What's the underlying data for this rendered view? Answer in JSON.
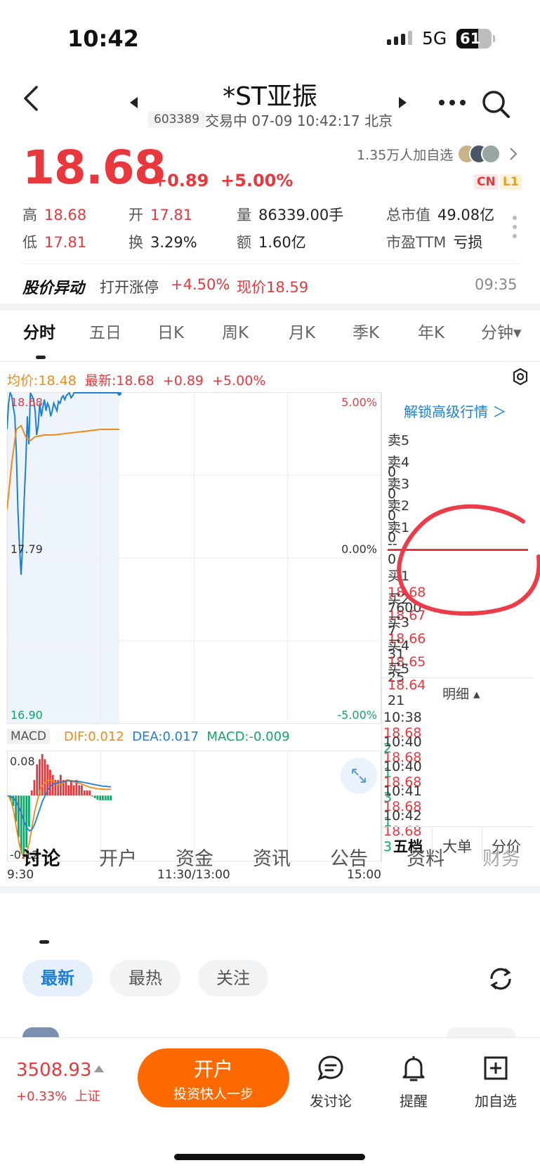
{
  "status_bar": {
    "time": "10:42",
    "network": "5G",
    "battery_level": 61,
    "battery_text": "61"
  },
  "header": {
    "title": "*ST亚振",
    "code": "603389",
    "subtitle": "交易中 07-09 10:42:17 北京"
  },
  "quote": {
    "price": "18.68",
    "change": "+0.89",
    "change_pct": "+5.00%",
    "fans": "1.35万人加自选",
    "tag_cn": "CN",
    "tag_l1": "L1",
    "high_label": "高",
    "high": "18.68",
    "open_label": "开",
    "open": "17.81",
    "volume_label": "量",
    "volume": "86339.00手",
    "mktcap_label": "总市值",
    "mktcap": "49.08亿",
    "low_label": "低",
    "low": "17.81",
    "turnover_label": "换",
    "turnover": "3.29%",
    "amount_label": "额",
    "amount": "1.60亿",
    "pe_label": "市盈TTM",
    "pe": "亏损"
  },
  "alert": {
    "title": "股价异动",
    "text": "打开涨停",
    "pct": "+4.50%",
    "price_text": "现价18.59",
    "time": "09:35"
  },
  "chart_tabs": [
    "分时",
    "五日",
    "日K",
    "周K",
    "月K",
    "季K",
    "年K",
    "分钟▾"
  ],
  "info_line": {
    "avg": "均价:18.48",
    "latest": "最新:18.68",
    "chg": "+0.89",
    "pct": "+5.00%"
  },
  "chart_data": {
    "type": "line",
    "y_left_ticks": [
      "18.68",
      "17.79",
      "16.90"
    ],
    "y_right_ticks": [
      "5.00%",
      "0.00%",
      "-5.00%"
    ],
    "x_ticks": [
      "9:30",
      "11:30/13:00",
      "15:00"
    ],
    "ylim": [
      16.9,
      18.68
    ],
    "series": [
      {
        "name": "price",
        "color": "#1e7fd6",
        "x": [
          0,
          1,
          2,
          3,
          4,
          5,
          6,
          7,
          8,
          9,
          10,
          11,
          12,
          13,
          14,
          15,
          16,
          17,
          18,
          19,
          20,
          21,
          22,
          23,
          24,
          25,
          26,
          27,
          28,
          29,
          30,
          31,
          32,
          33,
          34,
          35,
          36,
          37,
          38,
          39,
          40,
          41,
          42,
          43,
          44,
          45,
          46,
          47,
          48,
          49,
          50,
          51,
          52,
          53,
          54,
          55,
          56,
          57,
          58,
          59,
          60,
          61,
          62,
          63,
          64,
          65,
          66,
          67,
          68,
          69,
          70,
          71,
          72
        ],
        "values": [
          18.48,
          18.62,
          18.68,
          18.66,
          18.6,
          18.55,
          18.35,
          18.05,
          17.85,
          17.7,
          17.85,
          18.1,
          18.3,
          18.55,
          18.4,
          18.68,
          18.66,
          18.64,
          18.58,
          18.45,
          18.5,
          18.62,
          18.55,
          18.6,
          18.64,
          18.58,
          18.62,
          18.6,
          18.55,
          18.58,
          18.62,
          18.6,
          18.58,
          18.63,
          18.62,
          18.65,
          18.66,
          18.64,
          18.66,
          18.67,
          18.68,
          18.65,
          18.66,
          18.68,
          18.68,
          18.68,
          18.68,
          18.68,
          18.68,
          18.68,
          18.68,
          18.68,
          18.68,
          18.68,
          18.68,
          18.68,
          18.68,
          18.68,
          18.68,
          18.68,
          18.68,
          18.68,
          18.68,
          18.68,
          18.68,
          18.68,
          18.68,
          18.68,
          18.68,
          18.68,
          18.68,
          18.68,
          18.68
        ]
      },
      {
        "name": "avg",
        "color": "#f28a18",
        "x": [
          0,
          3,
          6,
          9,
          12,
          15,
          18,
          24,
          30,
          40,
          50,
          60,
          72
        ],
        "values": [
          18.05,
          18.3,
          18.48,
          18.5,
          18.44,
          18.42,
          18.44,
          18.45,
          18.45,
          18.46,
          18.47,
          18.48,
          18.48
        ]
      }
    ],
    "macd": {
      "label": "MACD",
      "dif": "DIF:0.012",
      "dea": "DEA:0.017",
      "macd": "MACD:-0.009",
      "y_ticks": [
        "0.08",
        "-0.12"
      ],
      "ylim": [
        -0.12,
        0.08
      ],
      "bars": [
        0,
        -0.01,
        -0.02,
        -0.05,
        -0.08,
        -0.11,
        -0.12,
        -0.1,
        -0.06,
        0.01,
        0.03,
        0.06,
        0.07,
        0.08,
        0.07,
        0.06,
        0.05,
        0.04,
        0.03,
        0.03,
        0.04,
        0.03,
        0.03,
        0.02,
        0.03,
        0.02,
        0.03,
        0.02,
        0.02,
        0.01,
        0.01,
        0.01,
        0.0,
        -0.005,
        -0.008,
        -0.009,
        -0.009,
        -0.009,
        -0.009,
        -0.009
      ],
      "dif_line": [
        0,
        -0.01,
        -0.03,
        -0.06,
        -0.09,
        -0.11,
        -0.12,
        -0.11,
        -0.09,
        -0.06,
        -0.03,
        -0.01,
        0.01,
        0.02,
        0.025,
        0.03,
        0.03,
        0.028,
        0.025,
        0.02,
        0.022,
        0.025,
        0.03,
        0.03,
        0.028,
        0.026,
        0.025,
        0.024,
        0.022,
        0.02,
        0.018,
        0.016,
        0.015,
        0.014,
        0.013,
        0.013,
        0.012,
        0.012,
        0.012,
        0.012
      ],
      "dea_line": [
        0,
        -0.002,
        -0.005,
        -0.012,
        -0.022,
        -0.035,
        -0.05,
        -0.062,
        -0.068,
        -0.065,
        -0.055,
        -0.04,
        -0.025,
        -0.01,
        0.0,
        0.01,
        0.018,
        0.022,
        0.024,
        0.025,
        0.026,
        0.027,
        0.028,
        0.028,
        0.028,
        0.028,
        0.027,
        0.027,
        0.026,
        0.025,
        0.024,
        0.023,
        0.022,
        0.021,
        0.02,
        0.019,
        0.018,
        0.018,
        0.017,
        0.017
      ]
    }
  },
  "order_book": {
    "unlock": "解锁高级行情 ＞",
    "asks": [
      {
        "label": "卖5",
        "price": "--",
        "vol": "0"
      },
      {
        "label": "卖4",
        "price": "--",
        "vol": "0"
      },
      {
        "label": "卖3",
        "price": "--",
        "vol": "0"
      },
      {
        "label": "卖2",
        "price": "--",
        "vol": "0"
      },
      {
        "label": "卖1",
        "price": "--",
        "vol": "0"
      }
    ],
    "bids": [
      {
        "label": "买1",
        "price": "18.68",
        "vol": "7600"
      },
      {
        "label": "买2",
        "price": "18.67",
        "vol": "7"
      },
      {
        "label": "买3",
        "price": "18.66",
        "vol": "31"
      },
      {
        "label": "买4",
        "price": "18.65",
        "vol": "25"
      },
      {
        "label": "买5",
        "price": "18.64",
        "vol": "21"
      }
    ],
    "detail_title": "明细 ▴",
    "ticks": [
      {
        "time": "10:38",
        "price": "18.68",
        "vol": "2"
      },
      {
        "time": "10:40",
        "price": "18.68",
        "vol": "1"
      },
      {
        "time": "10:40",
        "price": "18.68",
        "vol": "3"
      },
      {
        "time": "10:41",
        "price": "18.68",
        "vol": "1"
      },
      {
        "time": "10:42",
        "price": "18.68",
        "vol": "3"
      }
    ],
    "tabs": [
      "五档",
      "大单",
      "分价"
    ]
  },
  "section_tabs": [
    "讨论",
    "开户",
    "资金",
    "资讯",
    "公告",
    "资料",
    "财务"
  ],
  "filter_pills": [
    "最新",
    "最热",
    "关注"
  ],
  "bottom_bar": {
    "index_value": "3508.93",
    "index_change": "+0.33%",
    "index_name": "上证",
    "open_title": "开户",
    "open_sub": "投资快人一步",
    "discuss": "发讨论",
    "remind": "提醒",
    "watch": "加自选"
  }
}
